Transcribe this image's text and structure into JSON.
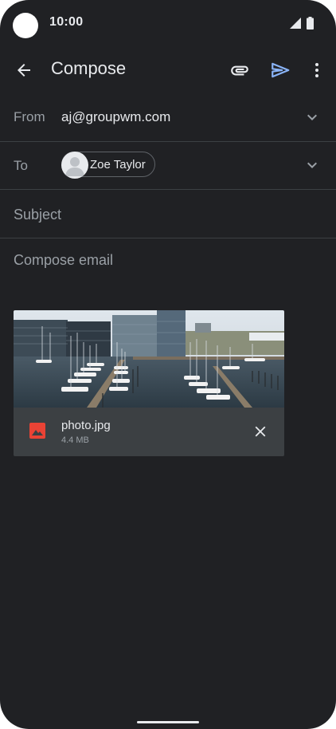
{
  "status_bar": {
    "time": "10:00",
    "icons": [
      "camera-cutout",
      "signal-icon",
      "battery-icon"
    ]
  },
  "app_bar": {
    "title": "Compose",
    "icons": [
      "back-arrow-icon",
      "attach-icon",
      "send-icon",
      "more-vert-icon"
    ]
  },
  "from": {
    "label": "From",
    "value": "aj@groupwm.com"
  },
  "to": {
    "label": "To",
    "recipient_name": "Zoe Taylor"
  },
  "subject": {
    "placeholder": "Subject",
    "value": ""
  },
  "body": {
    "placeholder": "Compose email",
    "value": ""
  },
  "attachment": {
    "file_name": "photo.jpg",
    "file_size": "4.4 MB",
    "icon": "image-file-icon"
  },
  "colors": {
    "background": "#202124",
    "text_primary": "#e8eaed",
    "text_secondary": "#9aa0a6",
    "send_accent": "#8ab4f8",
    "attachment_card": "#3c4043",
    "image_icon": "#ea4335",
    "divider": "#3c4043"
  }
}
